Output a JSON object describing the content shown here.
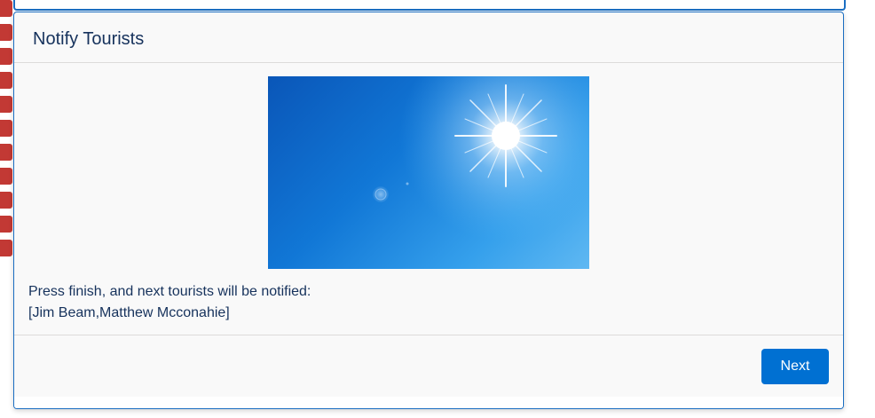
{
  "modal": {
    "title": "Notify Tourists",
    "image_icon": "sunny-sky-photo",
    "message_line1": "Press finish, and next tourists will be notified:",
    "message_line2": "[Jim Beam,Matthew Mcconahie]",
    "next_label": "Next"
  },
  "side_tags": {
    "count": 11,
    "color": "#c23934"
  },
  "colors": {
    "accent": "#0070d2",
    "border": "#1b6ec2",
    "title_text": "#16325c"
  }
}
